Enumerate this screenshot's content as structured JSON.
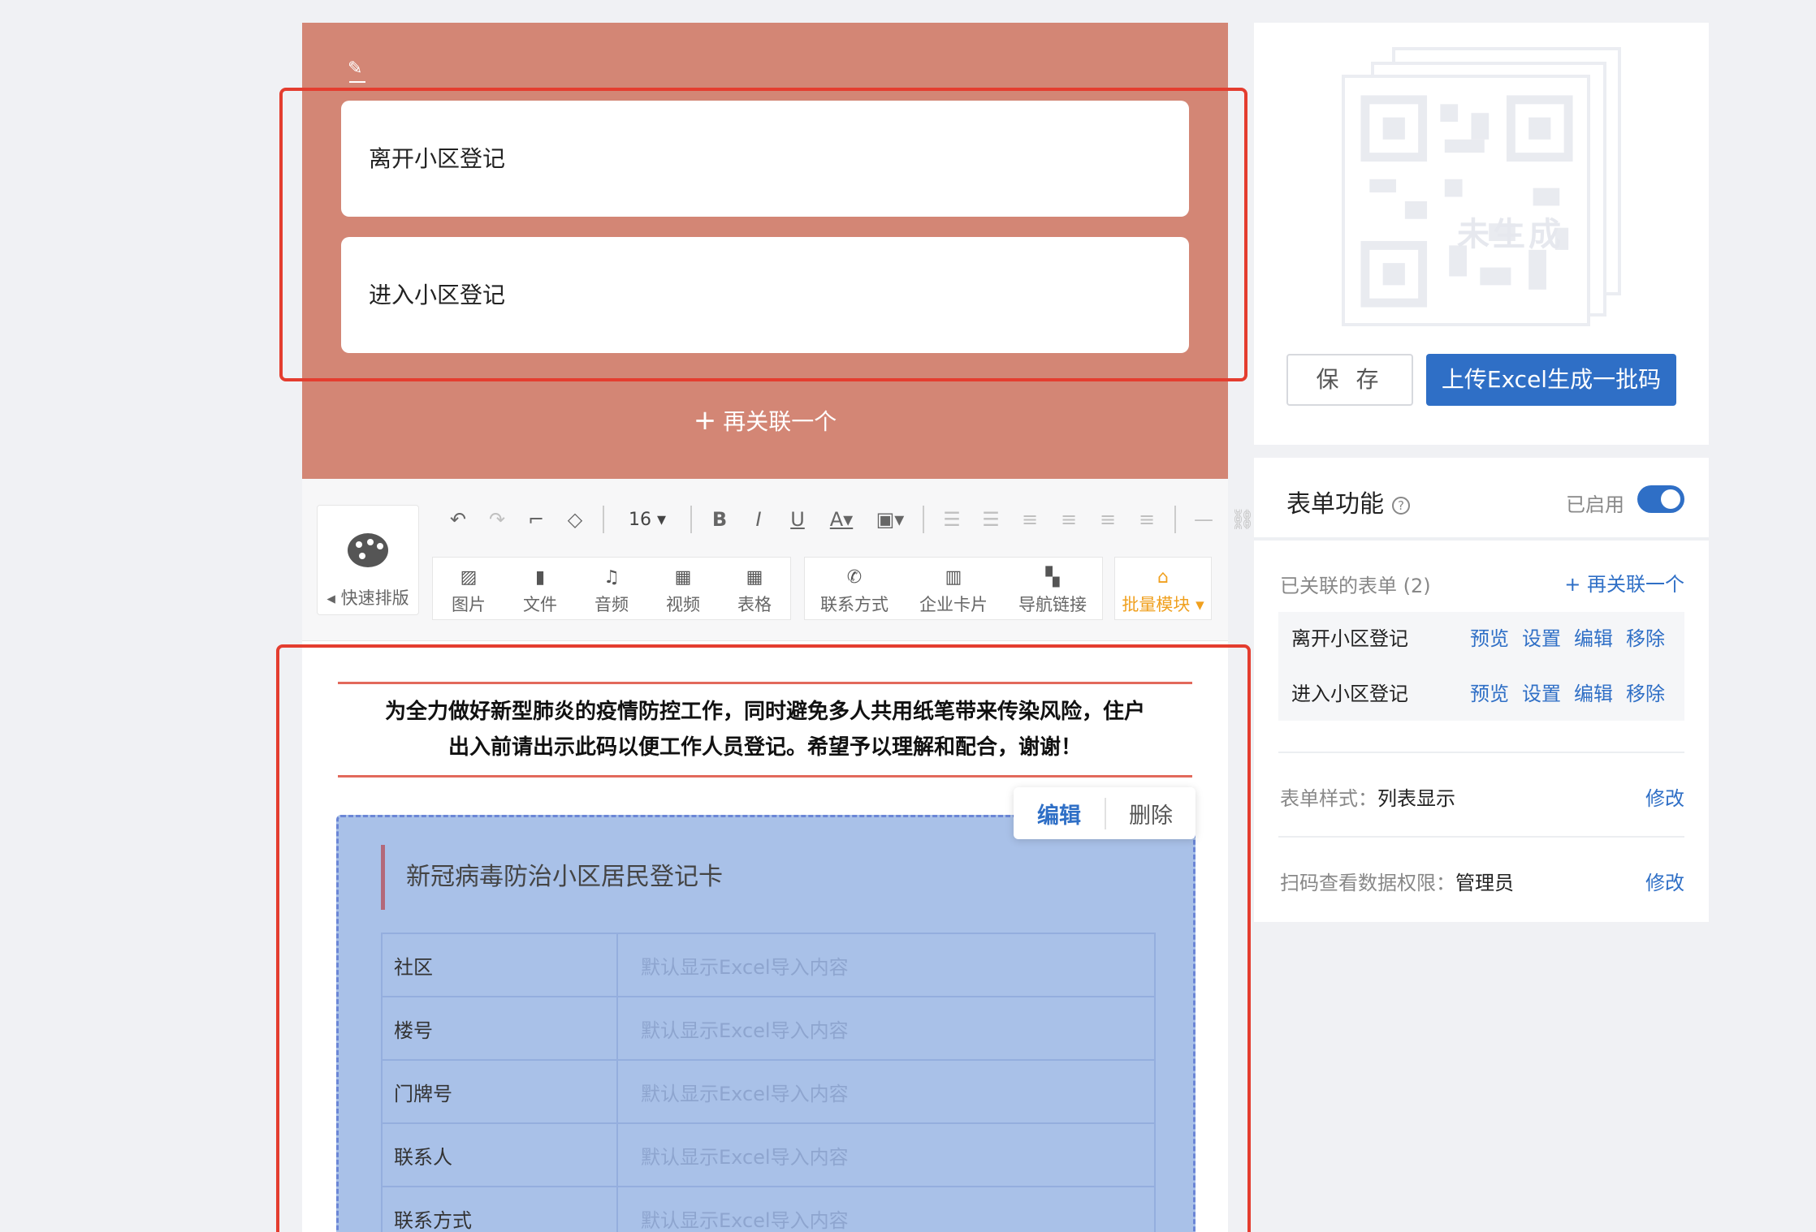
{
  "form_block": {
    "cards": [
      "离开小区登记",
      "进入小区登记"
    ],
    "add_more": "再关联一个"
  },
  "toolbar": {
    "quick_layout": "快速排版",
    "font_size": "16",
    "format_buttons": [
      "undo-icon",
      "redo-icon",
      "format-painter-icon",
      "eraser-icon",
      "bold-icon",
      "italic-icon",
      "underline-icon",
      "font-color-icon",
      "highlight-icon",
      "ordered-list-icon",
      "unordered-list-icon",
      "align-left-icon",
      "align-center-icon",
      "align-right-icon",
      "justify-icon",
      "divider-icon",
      "link-icon"
    ],
    "insert_media": [
      "图片",
      "文件",
      "音频",
      "视频",
      "表格"
    ],
    "insert_contact": [
      "联系方式",
      "企业卡片",
      "导航链接"
    ],
    "batch": "批量模块"
  },
  "content": {
    "notice_line1": "为全力做好新型肺炎的疫情防控工作，同时避免多人共用纸笔带来传染风险，住户",
    "notice_line2": "出入前请出示此码以便工作人员登记。希望予以理解和配合，谢谢！",
    "edit_label": "编辑",
    "delete_label": "删除",
    "card_title": "新冠病毒防治小区居民登记卡",
    "rows": [
      {
        "k": "社区",
        "v": "默认显示Excel导入内容"
      },
      {
        "k": "楼号",
        "v": "默认显示Excel导入内容"
      },
      {
        "k": "门牌号",
        "v": "默认显示Excel导入内容"
      },
      {
        "k": "联系人",
        "v": "默认显示Excel导入内容"
      },
      {
        "k": "联系方式",
        "v": "默认显示Excel导入内容"
      }
    ]
  },
  "qr": {
    "status": "未生成",
    "save": "保 存",
    "upload": "上传Excel生成一批码"
  },
  "func": {
    "title": "表单功能",
    "enabled": "已启用",
    "linked_title": "已关联的表单 (2)",
    "linked_add": "再关联一个",
    "linked": [
      {
        "name": "离开小区登记",
        "actions": [
          "预览",
          "设置",
          "编辑",
          "移除"
        ]
      },
      {
        "name": "进入小区登记",
        "actions": [
          "预览",
          "设置",
          "编辑",
          "移除"
        ]
      }
    ],
    "style_key": "表单样式：",
    "style_val": "列表显示",
    "perm_key": "扫码查看数据权限：",
    "perm_val": "管理员",
    "modify": "修改"
  },
  "colors": {
    "accent": "#2f6fc6",
    "form_block_bg": "#d38675",
    "highlight_frame": "#e43d2f",
    "card_bg": "#a9c1e8",
    "batch": "#f0a01e"
  }
}
